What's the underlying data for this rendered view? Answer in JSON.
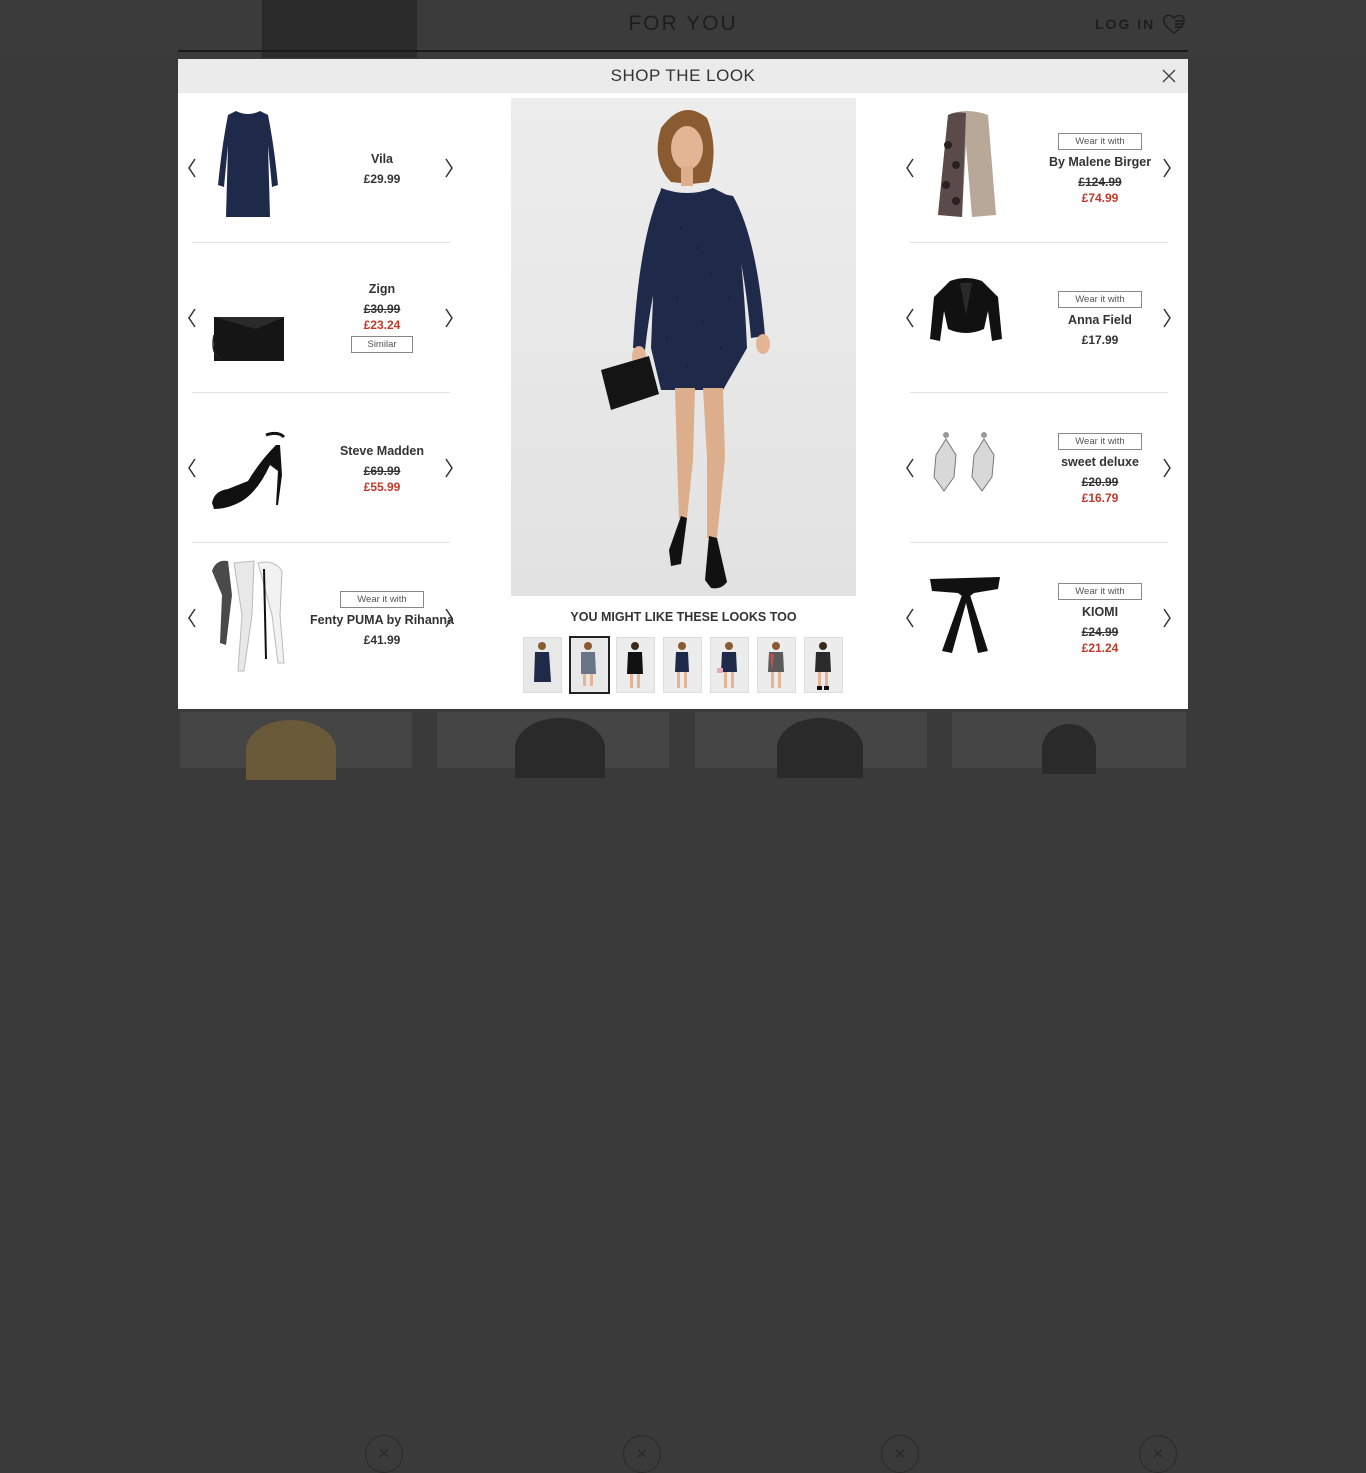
{
  "background": {
    "site_title": "FOR YOU",
    "login_label": "LOG IN"
  },
  "modal": {
    "title": "SHOP THE LOOK",
    "left_items": [
      {
        "brand": "Vila",
        "price": "£29.99",
        "old_price": "",
        "sale_price": "",
        "button": "",
        "image": "navy-dress"
      },
      {
        "brand": "Zign",
        "price": "",
        "old_price": "£30.99",
        "sale_price": "£23.24",
        "button": "Similar",
        "image": "black-clutch"
      },
      {
        "brand": "Steve Madden",
        "price": "",
        "old_price": "£69.99",
        "sale_price": "£55.99",
        "button": "",
        "image": "black-sandal"
      },
      {
        "brand": "Fenty PUMA by Rihanna",
        "price": "£41.99",
        "old_price": "",
        "sale_price": "",
        "button": "Wear it with",
        "image": "scarves"
      }
    ],
    "right_items": [
      {
        "brand": "By Malene Birger",
        "price": "",
        "old_price": "£124.99",
        "sale_price": "£74.99",
        "button": "Wear it with",
        "image": "scarf"
      },
      {
        "brand": "Anna Field",
        "price": "£17.99",
        "old_price": "",
        "sale_price": "",
        "button": "Wear it with",
        "image": "bolero"
      },
      {
        "brand": "sweet deluxe",
        "price": "",
        "old_price": "£20.99",
        "sale_price": "£16.79",
        "button": "Wear it with",
        "image": "earrings"
      },
      {
        "brand": "KIOMI",
        "price": "",
        "old_price": "£24.99",
        "sale_price": "£21.24",
        "button": "Wear it with",
        "image": "belt"
      }
    ],
    "looks_title": "YOU MIGHT LIKE THESE LOOKS TOO",
    "looks_count": 7,
    "active_look": 1
  },
  "colors": {
    "sale": "#c0392b",
    "navy": "#1f2a4a",
    "overlay": "#3a3a3a"
  }
}
